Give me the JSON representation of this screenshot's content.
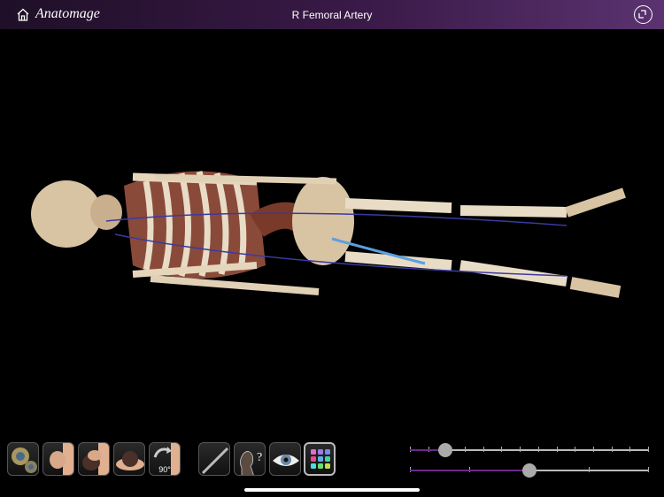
{
  "header": {
    "logo": "Anatomage",
    "title": "R Femoral Artery",
    "home_icon": "home-icon",
    "exit_icon": "exit-fullscreen-icon"
  },
  "toolbar": {
    "rotate_label": "90°",
    "tools": [
      "settings-gears",
      "front-view",
      "side-view",
      "top-view",
      "rotate-90",
      "scalpel",
      "identify",
      "visibility",
      "palette"
    ]
  },
  "sliders": {
    "top_value_percent": 15,
    "bottom_value_percent": 50
  },
  "colors": {
    "accent": "#6a2a8a",
    "header_start": "#1f0f27",
    "header_end": "#5a3370"
  }
}
